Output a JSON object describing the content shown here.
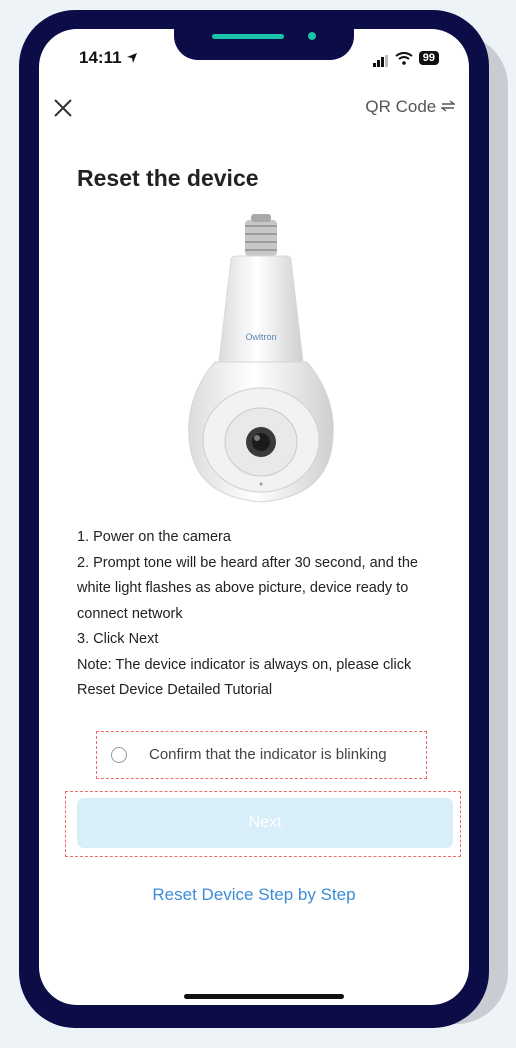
{
  "status_bar": {
    "time": "14:11",
    "battery": "99"
  },
  "header": {
    "close_icon": "close-icon",
    "qr_label": "QR Code",
    "qr_icon": "swap-icon"
  },
  "page": {
    "title": "Reset the device"
  },
  "device_image": {
    "brand_text": "Owltron"
  },
  "instructions": [
    "1. Power on the camera",
    "2. Prompt tone will be heard after 30 second, and the white light flashes as above picture, device ready to connect network",
    "3. Click Next",
    "Note: The device indicator is always on, please click Reset Device Detailed Tutorial"
  ],
  "confirm": {
    "label": "Confirm that the indicator is blinking",
    "checked": false
  },
  "next_button": {
    "label": "Next",
    "enabled": false
  },
  "tutorial_link": {
    "label": "Reset Device Step by Step"
  },
  "colors": {
    "frame": "#0c0c46",
    "accent": "#19c2a8",
    "link": "#3d8bd6",
    "next_disabled": "#d8eef9",
    "highlight": "#ef6b6b"
  }
}
